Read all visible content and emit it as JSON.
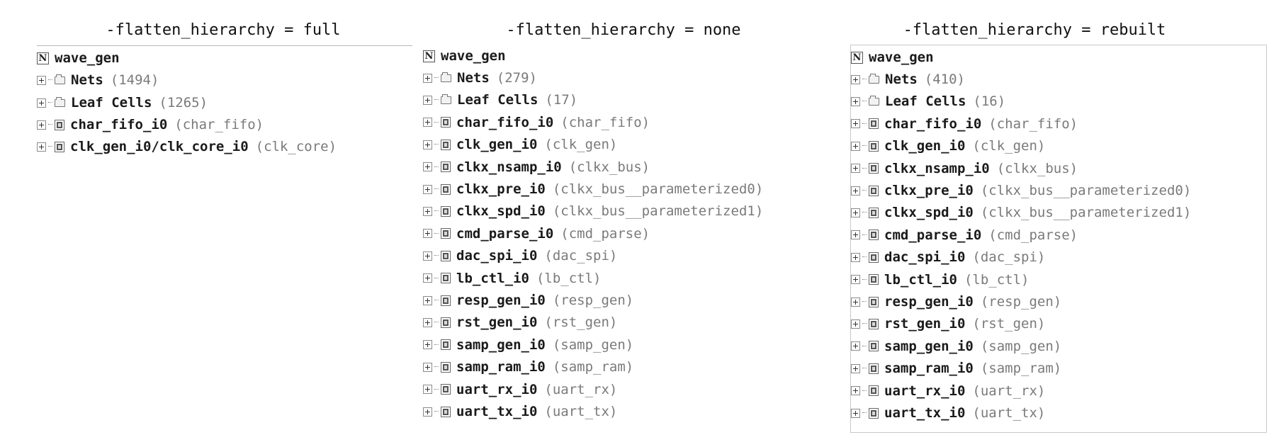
{
  "panels": [
    {
      "title": "-flatten_hierarchy = full",
      "root": {
        "name": "wave_gen",
        "icon": "netlist-icon"
      },
      "items": [
        {
          "kind": "folder",
          "name": "Nets",
          "info": "(1494)"
        },
        {
          "kind": "folder",
          "name": "Leaf Cells",
          "info": "(1265)"
        },
        {
          "kind": "cell",
          "name": "char_fifo_i0",
          "info": "(char_fifo)"
        },
        {
          "kind": "cell",
          "name": "clk_gen_i0/clk_core_i0",
          "info": "(clk_core)"
        }
      ]
    },
    {
      "title": "-flatten_hierarchy = none",
      "root": {
        "name": "wave_gen",
        "icon": "netlist-icon"
      },
      "items": [
        {
          "kind": "folder",
          "name": "Nets",
          "info": "(279)"
        },
        {
          "kind": "folder",
          "name": "Leaf Cells",
          "info": "(17)"
        },
        {
          "kind": "cell",
          "name": "char_fifo_i0",
          "info": "(char_fifo)"
        },
        {
          "kind": "cell",
          "name": "clk_gen_i0",
          "info": "(clk_gen)"
        },
        {
          "kind": "cell",
          "name": "clkx_nsamp_i0",
          "info": "(clkx_bus)"
        },
        {
          "kind": "cell",
          "name": "clkx_pre_i0",
          "info": "(clkx_bus__parameterized0)"
        },
        {
          "kind": "cell",
          "name": "clkx_spd_i0",
          "info": "(clkx_bus__parameterized1)"
        },
        {
          "kind": "cell",
          "name": "cmd_parse_i0",
          "info": "(cmd_parse)"
        },
        {
          "kind": "cell",
          "name": "dac_spi_i0",
          "info": "(dac_spi)"
        },
        {
          "kind": "cell",
          "name": "lb_ctl_i0",
          "info": "(lb_ctl)"
        },
        {
          "kind": "cell",
          "name": "resp_gen_i0",
          "info": "(resp_gen)"
        },
        {
          "kind": "cell",
          "name": "rst_gen_i0",
          "info": "(rst_gen)"
        },
        {
          "kind": "cell",
          "name": "samp_gen_i0",
          "info": "(samp_gen)"
        },
        {
          "kind": "cell",
          "name": "samp_ram_i0",
          "info": "(samp_ram)"
        },
        {
          "kind": "cell",
          "name": "uart_rx_i0",
          "info": "(uart_rx)"
        },
        {
          "kind": "cell",
          "name": "uart_tx_i0",
          "info": "(uart_tx)"
        }
      ]
    },
    {
      "title": "-flatten_hierarchy = rebuilt",
      "root": {
        "name": "wave_gen",
        "icon": "netlist-icon"
      },
      "items": [
        {
          "kind": "folder",
          "name": "Nets",
          "info": "(410)"
        },
        {
          "kind": "folder",
          "name": "Leaf Cells",
          "info": "(16)"
        },
        {
          "kind": "cell",
          "name": "char_fifo_i0",
          "info": "(char_fifo)"
        },
        {
          "kind": "cell",
          "name": "clk_gen_i0",
          "info": "(clk_gen)"
        },
        {
          "kind": "cell",
          "name": "clkx_nsamp_i0",
          "info": "(clkx_bus)"
        },
        {
          "kind": "cell",
          "name": "clkx_pre_i0",
          "info": "(clkx_bus__parameterized0)"
        },
        {
          "kind": "cell",
          "name": "clkx_spd_i0",
          "info": "(clkx_bus__parameterized1)"
        },
        {
          "kind": "cell",
          "name": "cmd_parse_i0",
          "info": "(cmd_parse)"
        },
        {
          "kind": "cell",
          "name": "dac_spi_i0",
          "info": "(dac_spi)"
        },
        {
          "kind": "cell",
          "name": "lb_ctl_i0",
          "info": "(lb_ctl)"
        },
        {
          "kind": "cell",
          "name": "resp_gen_i0",
          "info": "(resp_gen)"
        },
        {
          "kind": "cell",
          "name": "rst_gen_i0",
          "info": "(rst_gen)"
        },
        {
          "kind": "cell",
          "name": "samp_gen_i0",
          "info": "(samp_gen)"
        },
        {
          "kind": "cell",
          "name": "samp_ram_i0",
          "info": "(samp_ram)"
        },
        {
          "kind": "cell",
          "name": "uart_rx_i0",
          "info": "(uart_rx)"
        },
        {
          "kind": "cell",
          "name": "uart_tx_i0",
          "info": "(uart_tx)"
        }
      ]
    }
  ]
}
